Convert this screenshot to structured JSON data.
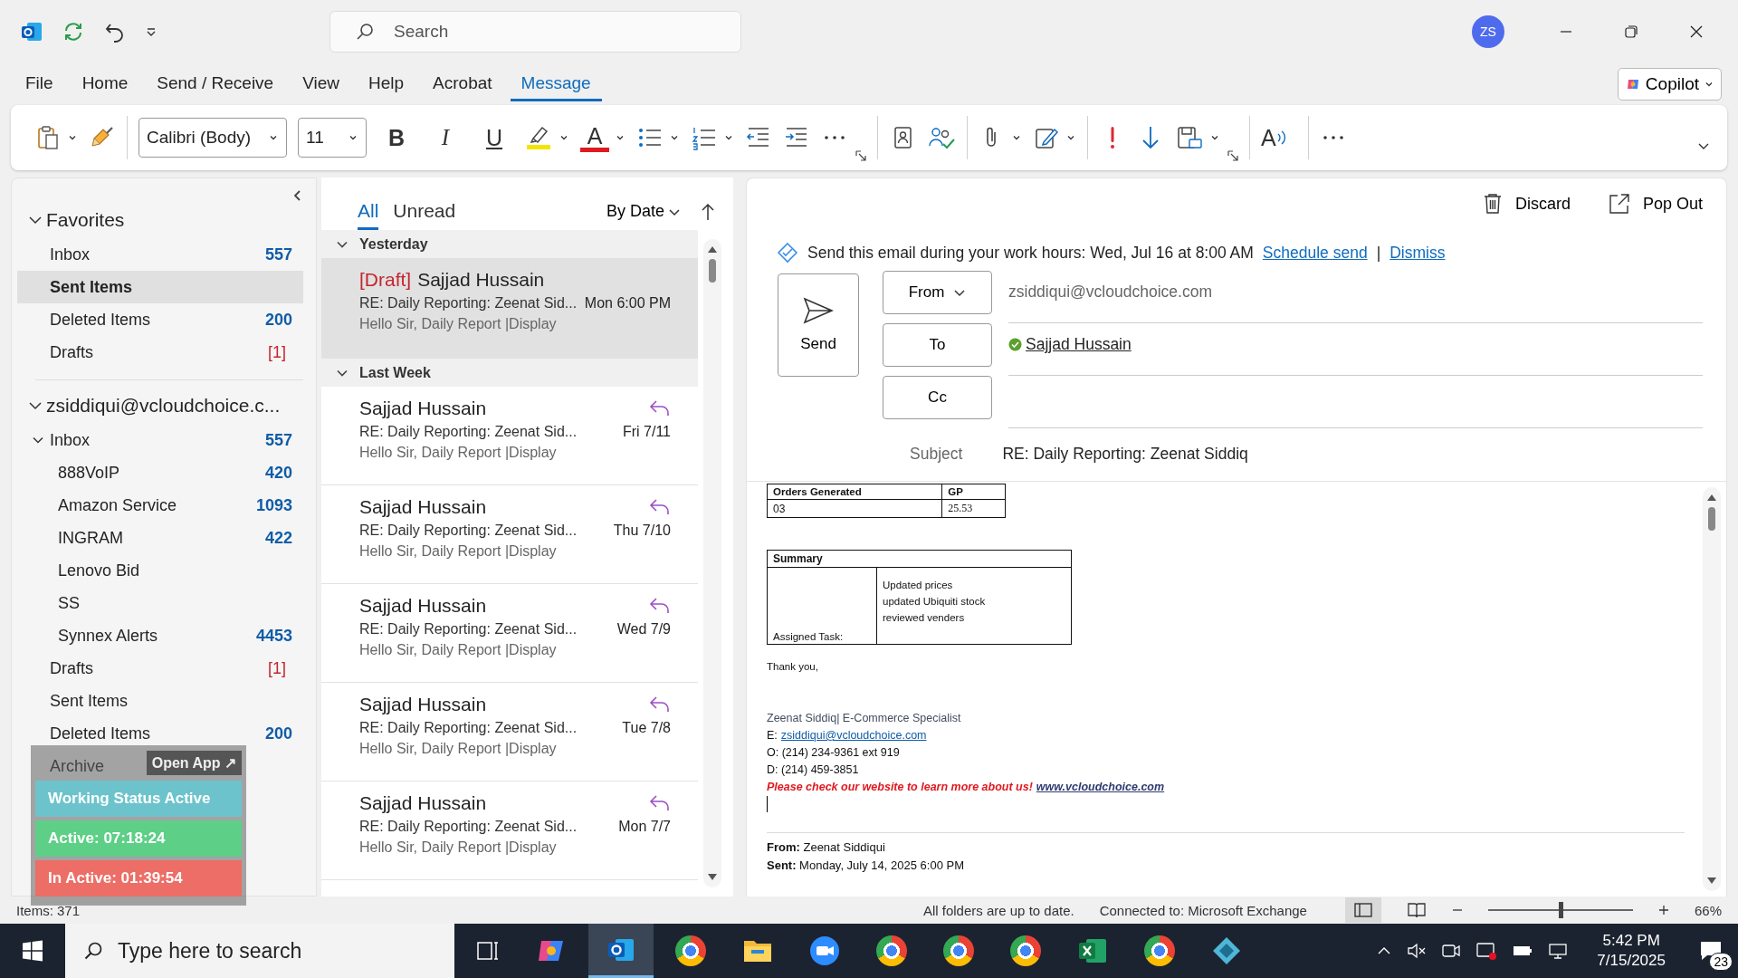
{
  "title_bar": {
    "search_placeholder": "Search",
    "avatar_initials": "ZS"
  },
  "menu": [
    {
      "label": "File",
      "selected": false
    },
    {
      "label": "Home",
      "selected": false
    },
    {
      "label": "Send / Receive",
      "selected": false
    },
    {
      "label": "View",
      "selected": false
    },
    {
      "label": "Help",
      "selected": false
    },
    {
      "label": "Acrobat",
      "selected": false
    },
    {
      "label": "Message",
      "selected": true
    }
  ],
  "copilot": {
    "label": "Copilot"
  },
  "ribbon": {
    "font_name": "Calibri (Body)",
    "font_size": "11",
    "bold": "B",
    "italic": "I",
    "underline": "U",
    "font_color": "A",
    "read_aloud": "A"
  },
  "favorites": {
    "title": "Favorites",
    "expanded": true,
    "items": [
      {
        "label": "Inbox",
        "count": "557",
        "kind": "unread",
        "selected": false
      },
      {
        "label": "Sent Items",
        "selected": true
      },
      {
        "label": "Deleted Items",
        "count": "200",
        "kind": "unread",
        "selected": false
      },
      {
        "label": "Drafts",
        "count": "[1]",
        "kind": "draft",
        "selected": false
      }
    ]
  },
  "account": {
    "title": "zsiddiqui@vcloudchoice.c...",
    "expanded": true,
    "folders": [
      {
        "label": "Inbox",
        "count": "557",
        "kind": "unread",
        "selected": false,
        "expanded": true,
        "children": [
          {
            "label": "888VoIP",
            "count": "420",
            "kind": "unread",
            "selected": false
          },
          {
            "label": "Amazon Service",
            "count": "1093",
            "kind": "unread",
            "selected": false
          },
          {
            "label": "INGRAM",
            "count": "422",
            "kind": "unread",
            "selected": false
          },
          {
            "label": "Lenovo Bid",
            "selected": false
          },
          {
            "label": "SS",
            "selected": false
          },
          {
            "label": "Synnex Alerts",
            "count": "4453",
            "kind": "unread",
            "selected": false
          }
        ]
      },
      {
        "label": "Drafts",
        "count": "[1]",
        "kind": "draft",
        "selected": false
      },
      {
        "label": "Sent Items",
        "selected": false
      },
      {
        "label": "Deleted Items",
        "count": "200",
        "kind": "unread",
        "selected": false
      },
      {
        "label": "Archive",
        "selected": false
      }
    ]
  },
  "message_list": {
    "tabs": [
      {
        "label": "All",
        "selected": true
      },
      {
        "label": "Unread",
        "selected": false
      }
    ],
    "sort": "By Date",
    "groups": [
      {
        "title": "Yesterday",
        "expanded": true,
        "messages": [
          {
            "draft_tag": "[Draft]",
            "sender": "Sajjad Hussain",
            "subject": "RE: Daily Reporting: Zeenat Sid...",
            "preview": "Hello Sir,  Daily Report |Display",
            "date": "Mon 6:00 PM",
            "replied": false,
            "selected": true
          }
        ]
      },
      {
        "title": "Last Week",
        "expanded": true,
        "messages": [
          {
            "sender": "Sajjad Hussain",
            "subject": "RE: Daily Reporting: Zeenat Sid...",
            "preview": "Hello Sir,  Daily Report |Display",
            "date": "Fri 7/11",
            "replied": true,
            "selected": false
          },
          {
            "sender": "Sajjad Hussain",
            "subject": "RE: Daily Reporting: Zeenat Sid...",
            "preview": "Hello Sir,  Daily Report |Display",
            "date": "Thu 7/10",
            "replied": true,
            "selected": false
          },
          {
            "sender": "Sajjad Hussain",
            "subject": "RE: Daily Reporting: Zeenat Sid...",
            "preview": "Hello Sir,  Daily Report |Display",
            "date": "Wed 7/9",
            "replied": true,
            "selected": false
          },
          {
            "sender": "Sajjad Hussain",
            "subject": "RE: Daily Reporting: Zeenat Sid...",
            "preview": "Hello Sir,  Daily Report |Display",
            "date": "Tue 7/8",
            "replied": true,
            "selected": false
          },
          {
            "sender": "Sajjad Hussain",
            "subject": "RE: Daily Reporting: Zeenat Sid...",
            "preview": "Hello Sir,  Daily Report |Display",
            "date": "Mon 7/7",
            "replied": true,
            "selected": false
          }
        ]
      }
    ]
  },
  "compose": {
    "discard": "Discard",
    "pop_out": "Pop Out",
    "notice": {
      "text": "Send this email during your work hours: Wed, Jul 16 at 8:00 AM",
      "schedule_link": "Schedule send",
      "separator": "|",
      "dismiss_link": "Dismiss"
    },
    "send": "Send",
    "from": {
      "label": "From",
      "value": "zsiddiqui@vcloudchoice.com"
    },
    "to": {
      "label": "To",
      "recipients": [
        "Sajjad Hussain"
      ]
    },
    "cc": {
      "label": "Cc"
    },
    "subject": {
      "label": "Subject",
      "value": "RE: Daily Reporting: Zeenat Siddiq"
    }
  },
  "body": {
    "stats_table": {
      "columns": [
        "Orders Generated",
        "GP"
      ],
      "rows": [
        [
          "03",
          "25.53"
        ]
      ]
    },
    "summary_table": {
      "title": "Summary",
      "label": "Assigned Task:",
      "tasks": [
        "Updated prices",
        "updated Ubiquiti stock",
        "reviewed venders"
      ]
    },
    "closing": "Thank you,",
    "signature": {
      "name_line": "Zeenat Siddiq| E-Commerce Specialist",
      "email_label": "E:",
      "email": "zsiddiqui@vcloudchoice.com",
      "office": "O: (214) 234-9361 ext 919",
      "direct": "D: (214) 459-3851",
      "promo": "Please check our website to learn more about us!",
      "website": "www.vcloudchoice.com"
    },
    "quoted": [
      "**From:** Zeenat Siddiqui",
      "**Sent:** Monday, July 14, 2025 6:00 PM"
    ]
  },
  "widget": {
    "open_app": "Open App ↗",
    "rows": [
      {
        "label": "Working Status Active",
        "color": "#6cc3cc"
      },
      {
        "label": "Active: 07:18:24",
        "color": "#5dcf86"
      },
      {
        "label": "In Active: 01:39:54",
        "color": "#ec6e66"
      }
    ]
  },
  "status_bar": {
    "items": "Items: 371",
    "sync": "All folders are up to date.",
    "connection": "Connected to: Microsoft Exchange",
    "zoom": {
      "level": 0.5,
      "reading": "66%"
    }
  },
  "taskbar": {
    "search_placeholder": "Type here to search",
    "time": "5:42 PM",
    "date": "7/15/2025",
    "notifications": "23"
  }
}
